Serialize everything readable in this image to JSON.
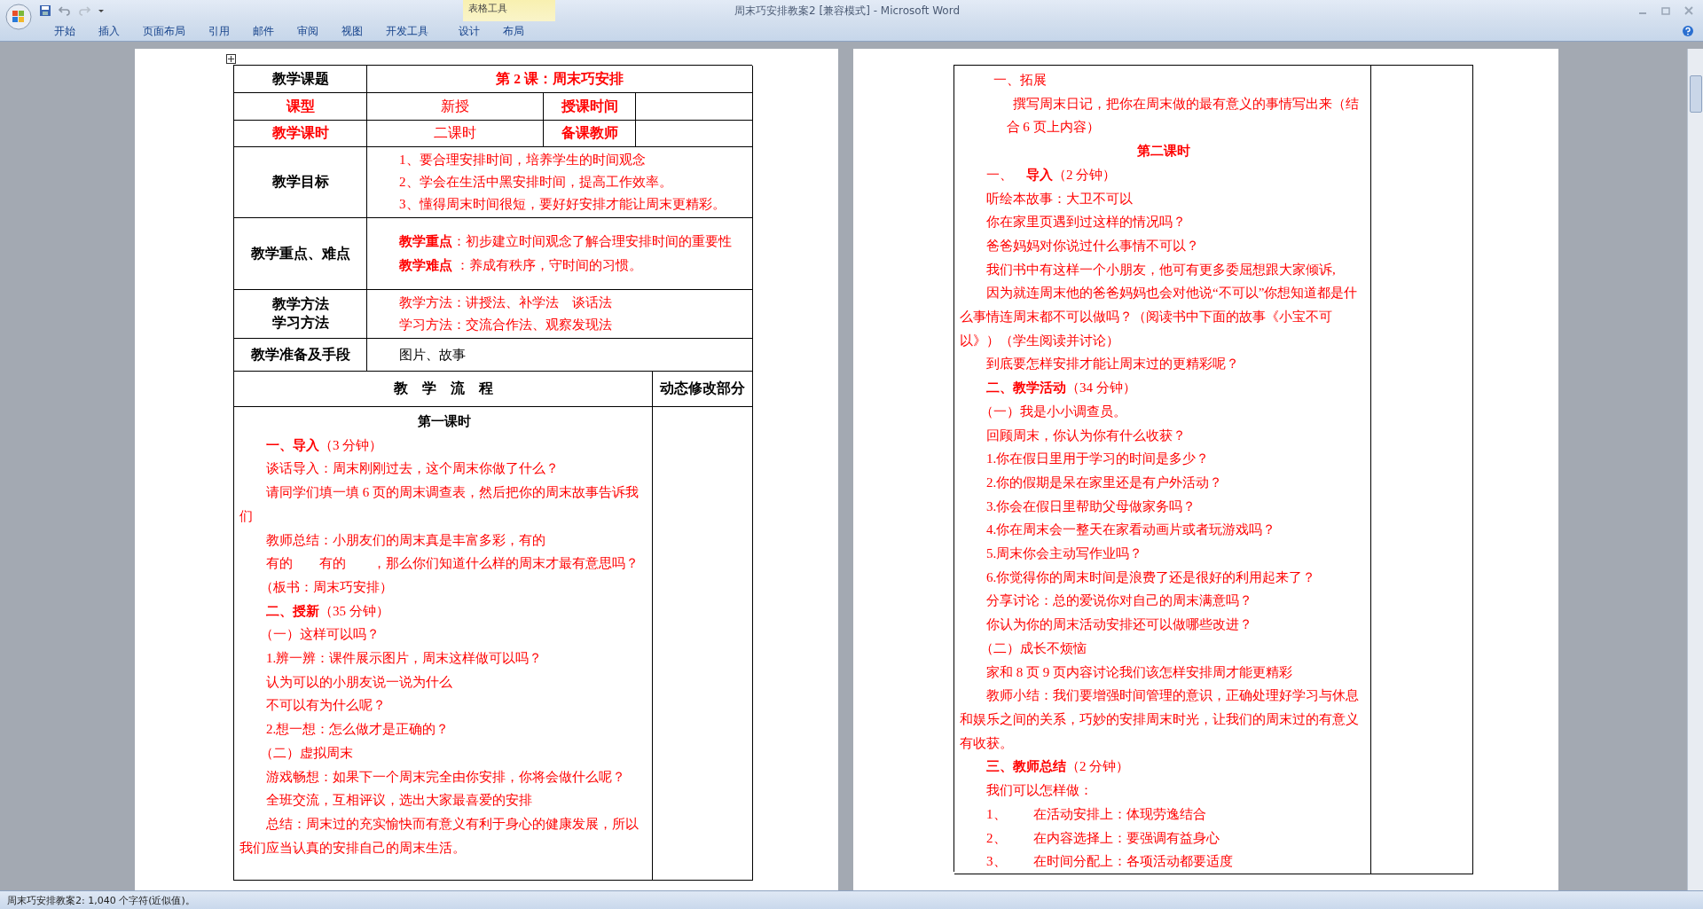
{
  "window": {
    "title": "周末巧安排教案2 [兼容模式] - Microsoft Word",
    "contextual_group": "表格工具"
  },
  "ribbon_tabs": [
    {
      "label": "开始"
    },
    {
      "label": "插入"
    },
    {
      "label": "页面布局"
    },
    {
      "label": "引用"
    },
    {
      "label": "邮件"
    },
    {
      "label": "审阅"
    },
    {
      "label": "视图"
    },
    {
      "label": "开发工具"
    }
  ],
  "table_tools_tabs": [
    {
      "label": "设计"
    },
    {
      "label": "布局"
    }
  ],
  "lesson_table": {
    "topic_label": "教学课题",
    "topic": "第 2 课：周末巧安排",
    "type_label": "课型",
    "type": "新授",
    "time_label": "授课时间",
    "hours_label": "教学课时",
    "hours": "二课时",
    "teacher_label": "备课教师",
    "goals_label": "教学目标",
    "goals": [
      "1、要合理安排时间，培养学生的时间观念",
      "2、学会在生活中黑安排时间，提高工作效率。",
      "3、懂得周末时间很短，要好好安排才能让周末更精彩。"
    ],
    "focus_label": "教学重点、难点",
    "focus": [
      "**教学重点**：初步建立时间观念了解合理安排时间的重要性",
      "**教学难点** ：养成有秩序，守时间的习惯。"
    ],
    "methods_labels": [
      "教学方法",
      "学习方法"
    ],
    "methods": [
      "教学方法：讲授法、补学法　谈话法",
      "学习方法：交流合作法、观察发现法"
    ],
    "prep_label": "教学准备及手段",
    "prep": "图片、故事",
    "flow_header": "教　学　流　程",
    "notes_header": "动态修改部分"
  },
  "left_flow": [
    {
      "kind": "title",
      "color": "#000000",
      "text": "第一课时"
    },
    {
      "kind": "para",
      "text": "**一、导入**（3 分钟）"
    },
    {
      "kind": "para",
      "text": "谈话导入：周末刚刚过去，这个周末你做了什么？"
    },
    {
      "kind": "para",
      "text": "请同学们填一填 6 页的周末调查表，然后把你的周末故事告诉我们"
    },
    {
      "kind": "para",
      "text": "教师总结：小朋友们的周末真是丰富多彩，有的"
    },
    {
      "kind": "para",
      "text": "有的　　有的　　，那么你们知道什么样的周末才最有意思吗？"
    },
    {
      "kind": "sub",
      "text": "（板书：周末巧安排）"
    },
    {
      "kind": "para",
      "text": "**二、授新**（35 分钟）"
    },
    {
      "kind": "sub",
      "text": "（一）这样可以吗？"
    },
    {
      "kind": "para",
      "text": "1.辨一辨：课件展示图片，周末这样做可以吗？"
    },
    {
      "kind": "para",
      "text": "认为可以的小朋友说一说为什么"
    },
    {
      "kind": "para",
      "text": "不可以有为什么呢？"
    },
    {
      "kind": "para",
      "text": "2.想一想：怎么做才是正确的？"
    },
    {
      "kind": "sub",
      "text": "（二）虚拟周末"
    },
    {
      "kind": "para",
      "text": "游戏畅想：如果下一个周末完全由你安排，你将会做什么呢？"
    },
    {
      "kind": "para",
      "text": "全班交流，互相评议，选出大家最喜爱的安排"
    },
    {
      "kind": "para",
      "text": "总结：周末过的充实愉快而有意义有利于身心的健康发展，所以我们应当认真的安排自己的周末生活。"
    }
  ],
  "right_flow": [
    {
      "kind": "lead",
      "text": "一、拓展"
    },
    {
      "kind": "hang",
      "text": "撰写周末日记，把你在周末做的最有意义的事情写出来（结合 6 页上内容）"
    },
    {
      "kind": "title",
      "color": "#ff0000",
      "text": "第二课时"
    },
    {
      "kind": "para",
      "text": "一、　**导入**（2 分钟）"
    },
    {
      "kind": "para",
      "text": "听绘本故事：大卫不可以"
    },
    {
      "kind": "para",
      "text": "你在家里页遇到过这样的情况吗？"
    },
    {
      "kind": "para",
      "text": "爸爸妈妈对你说过什么事情不可以？"
    },
    {
      "kind": "para",
      "text": "我们书中有这样一个小朋友，他可有更多委屈想跟大家倾诉,"
    },
    {
      "kind": "para",
      "text": "因为就连周末他的爸爸妈妈也会对他说“不可以”你想知道都是什么事情连周末都不可以做吗？（阅读书中下面的故事《小宝不可以》）（学生阅读并讨论）"
    },
    {
      "kind": "para",
      "text": "到底要怎样安排才能让周末过的更精彩呢？"
    },
    {
      "kind": "para",
      "text": "**二、教学活动**（34 分钟）"
    },
    {
      "kind": "sub",
      "text": "（一）我是小小调查员。"
    },
    {
      "kind": "para",
      "text": "回顾周末，你认为你有什么收获？"
    },
    {
      "kind": "para",
      "text": "1.你在假日里用于学习的时间是多少？"
    },
    {
      "kind": "para",
      "text": "2.你的假期是呆在家里还是有户外活动？"
    },
    {
      "kind": "para",
      "text": "3.你会在假日里帮助父母做家务吗？"
    },
    {
      "kind": "para",
      "text": "4.你在周末会一整天在家看动画片或者玩游戏吗？"
    },
    {
      "kind": "para",
      "text": "5.周末你会主动写作业吗？"
    },
    {
      "kind": "para",
      "text": "6.你觉得你的周末时间是浪费了还是很好的利用起来了？"
    },
    {
      "kind": "para",
      "text": "分享讨论：总的爱说你对自己的周末满意吗？"
    },
    {
      "kind": "para",
      "text": "你认为你的周末活动安排还可以做哪些改进？"
    },
    {
      "kind": "sub",
      "text": "（二）成长不烦恼"
    },
    {
      "kind": "para",
      "text": "家和 8 页 9 页内容讨论我们该怎样安排周才能更精彩"
    },
    {
      "kind": "para",
      "text": "教师小结：我们要增强时间管理的意识，正确处理好学习与休息和娱乐之间的关系，巧妙的安排周末时光，让我们的周末过的有意义有收获。"
    },
    {
      "kind": "para",
      "text": "**三、教师总结**（2 分钟）"
    },
    {
      "kind": "para",
      "text": "我们可以怎样做："
    },
    {
      "kind": "para",
      "text": "1、　　在活动安排上：体现劳逸结合"
    },
    {
      "kind": "para",
      "text": "2、　　在内容选择上：要强调有益身心"
    },
    {
      "kind": "para",
      "text": "3、　　在时间分配上：各项活动都要适度"
    }
  ],
  "status_bar": {
    "text": "周末巧安排教案2: 1,040 个字符(近似值)。"
  }
}
